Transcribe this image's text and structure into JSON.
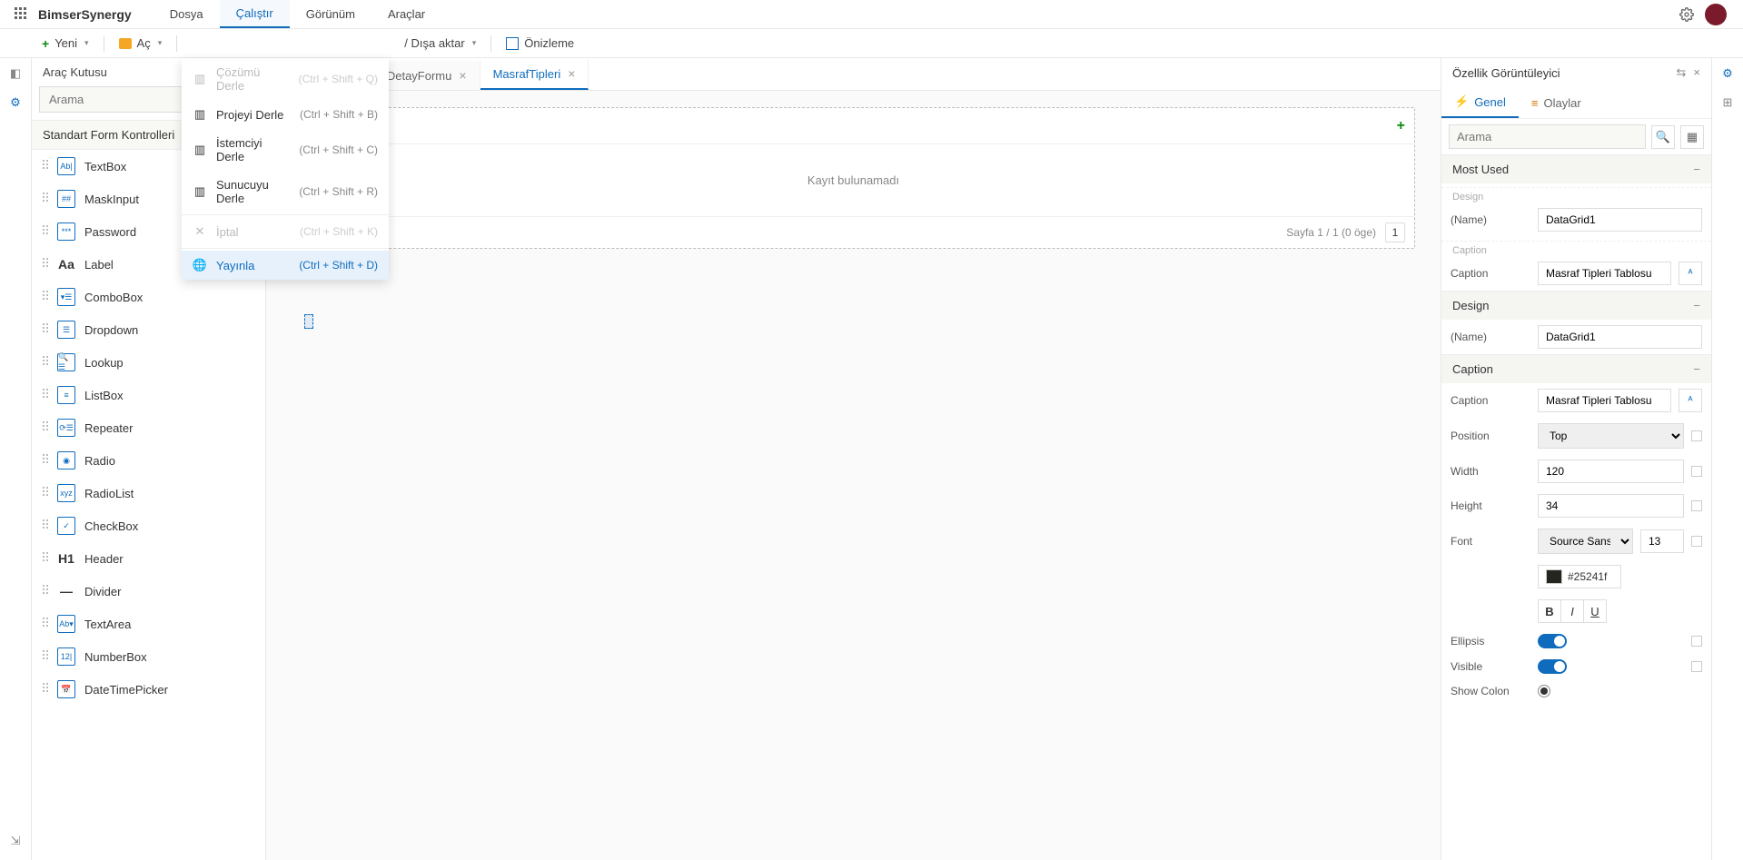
{
  "brand": "BimserSynergy",
  "menu": {
    "file": "Dosya",
    "run": "Çalıştır",
    "view": "Görünüm",
    "tools": "Araçlar"
  },
  "toolbar": {
    "new": "Yeni",
    "open": "Aç",
    "export": "/ Dışa aktar",
    "preview": "Önizleme"
  },
  "dropdown": {
    "build_solution": "Çözümü Derle",
    "sc1": "(Ctrl + Shift + Q)",
    "build_project": "Projeyi Derle",
    "sc2": "(Ctrl + Shift + B)",
    "build_client": "İstemciyi Derle",
    "sc3": "(Ctrl + Shift + C)",
    "build_server": "Sunucuyu Derle",
    "sc4": "(Ctrl + Shift + R)",
    "cancel": "İptal",
    "sc5": "(Ctrl + Shift + K)",
    "publish": "Yayınla",
    "sc6": "(Ctrl + Shift + D)"
  },
  "toolbox": {
    "title": "Araç Kutusu",
    "search_placeholder": "Arama",
    "group": "Standart Form Kontrolleri",
    "items": [
      "TextBox",
      "MaskInput",
      "Password",
      "Label",
      "ComboBox",
      "Dropdown",
      "Lookup",
      "ListBox",
      "Repeater",
      "Radio",
      "RadioList",
      "CheckBox",
      "Header",
      "Divider",
      "TextArea",
      "NumberBox",
      "DateTimePicker"
    ]
  },
  "tabs": {
    "t1": "afDetayFormu",
    "t2": "MasrafTipleri"
  },
  "grid": {
    "empty": "Kayıt bulunamadı",
    "pager": "Sayfa 1 / 1 (0 öge)",
    "page": "1"
  },
  "props": {
    "title": "Özellik Görüntüleyici",
    "tab_general": "Genel",
    "tab_events": "Olaylar",
    "search_placeholder": "Arama",
    "g_mostused": "Most Used",
    "sub_design": "Design",
    "sub_caption": "Caption",
    "g_design": "Design",
    "g_caption": "Caption",
    "l_name": "(Name)",
    "v_name": "DataGrid1",
    "l_caption": "Caption",
    "v_caption": "Masraf Tipleri Tablosu",
    "l_position": "Position",
    "v_position": "Top",
    "l_width": "Width",
    "v_width": "120",
    "l_height": "Height",
    "v_height": "34",
    "l_font": "Font",
    "v_font": "Source Sans…",
    "v_fontsize": "13",
    "v_color": "#25241f",
    "b": "B",
    "i": "I",
    "u": "U",
    "l_ellipsis": "Ellipsis",
    "l_visible": "Visible",
    "l_showcolon": "Show Colon"
  }
}
